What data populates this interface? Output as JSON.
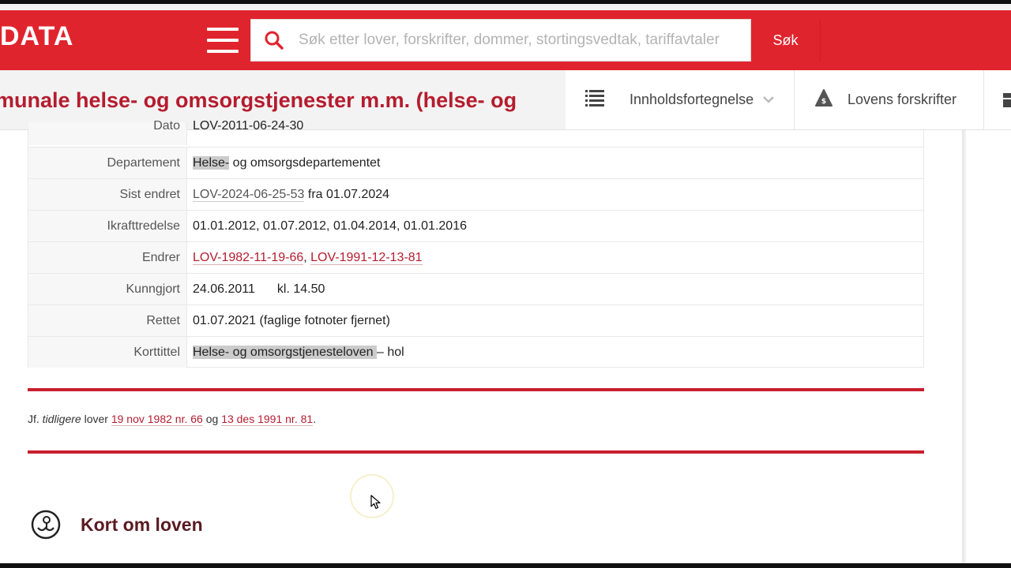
{
  "header": {
    "logo": "DATA",
    "search_placeholder": "Søk etter lover, forskrifter, dommer, stortingsvedtak, tariffavtaler",
    "search_button": "Søk"
  },
  "titlebar": {
    "title": "munale helse- og omsorgstjenester m.m. (helse- og",
    "nav_contents": "Innholdsfortegnelse",
    "nav_regulations": "Lovens forskrifter"
  },
  "meta": {
    "dato_label": "Dato",
    "dato_value": "LOV-2011-06-24-30",
    "departement_label": "Departement",
    "departement_hl": "Helse-",
    "departement_rest": " og omsorgsdepartementet",
    "sist_label": "Sist endret",
    "sist_link": "LOV-2024-06-25-53",
    "sist_rest": " fra 01.07.2024",
    "ikraft_label": "Ikrafttredelse",
    "ikraft_value": "01.01.2012, 01.07.2012, 01.04.2014, 01.01.2016",
    "endrer_label": "Endrer",
    "endrer_link1": "LOV-1982-11-19-66",
    "endrer_sep": ", ",
    "endrer_link2": "LOV-1991-12-13-81",
    "kunngjort_label": "Kunngjort",
    "kunngjort_date": "24.06.2011",
    "kunngjort_time": "kl. 14.50",
    "rettet_label": "Rettet",
    "rettet_value": "01.07.2021 (faglige fotnoter fjernet)",
    "korttittel_label": "Korttittel",
    "korttittel_hl": "Helse- og omsorgstjenesteloven ",
    "korttittel_rest": "– hol"
  },
  "note": {
    "prefix": "Jf. ",
    "italic": "tidligere",
    "middle": " lover ",
    "link1": "19 nov 1982 nr. 66",
    "and": " og ",
    "link2": "13 des 1991 nr. 81",
    "end": "."
  },
  "section": {
    "heading": "Kort om loven"
  },
  "colors": {
    "brand_red": "#e0242e",
    "title_red": "#b51c2e"
  }
}
